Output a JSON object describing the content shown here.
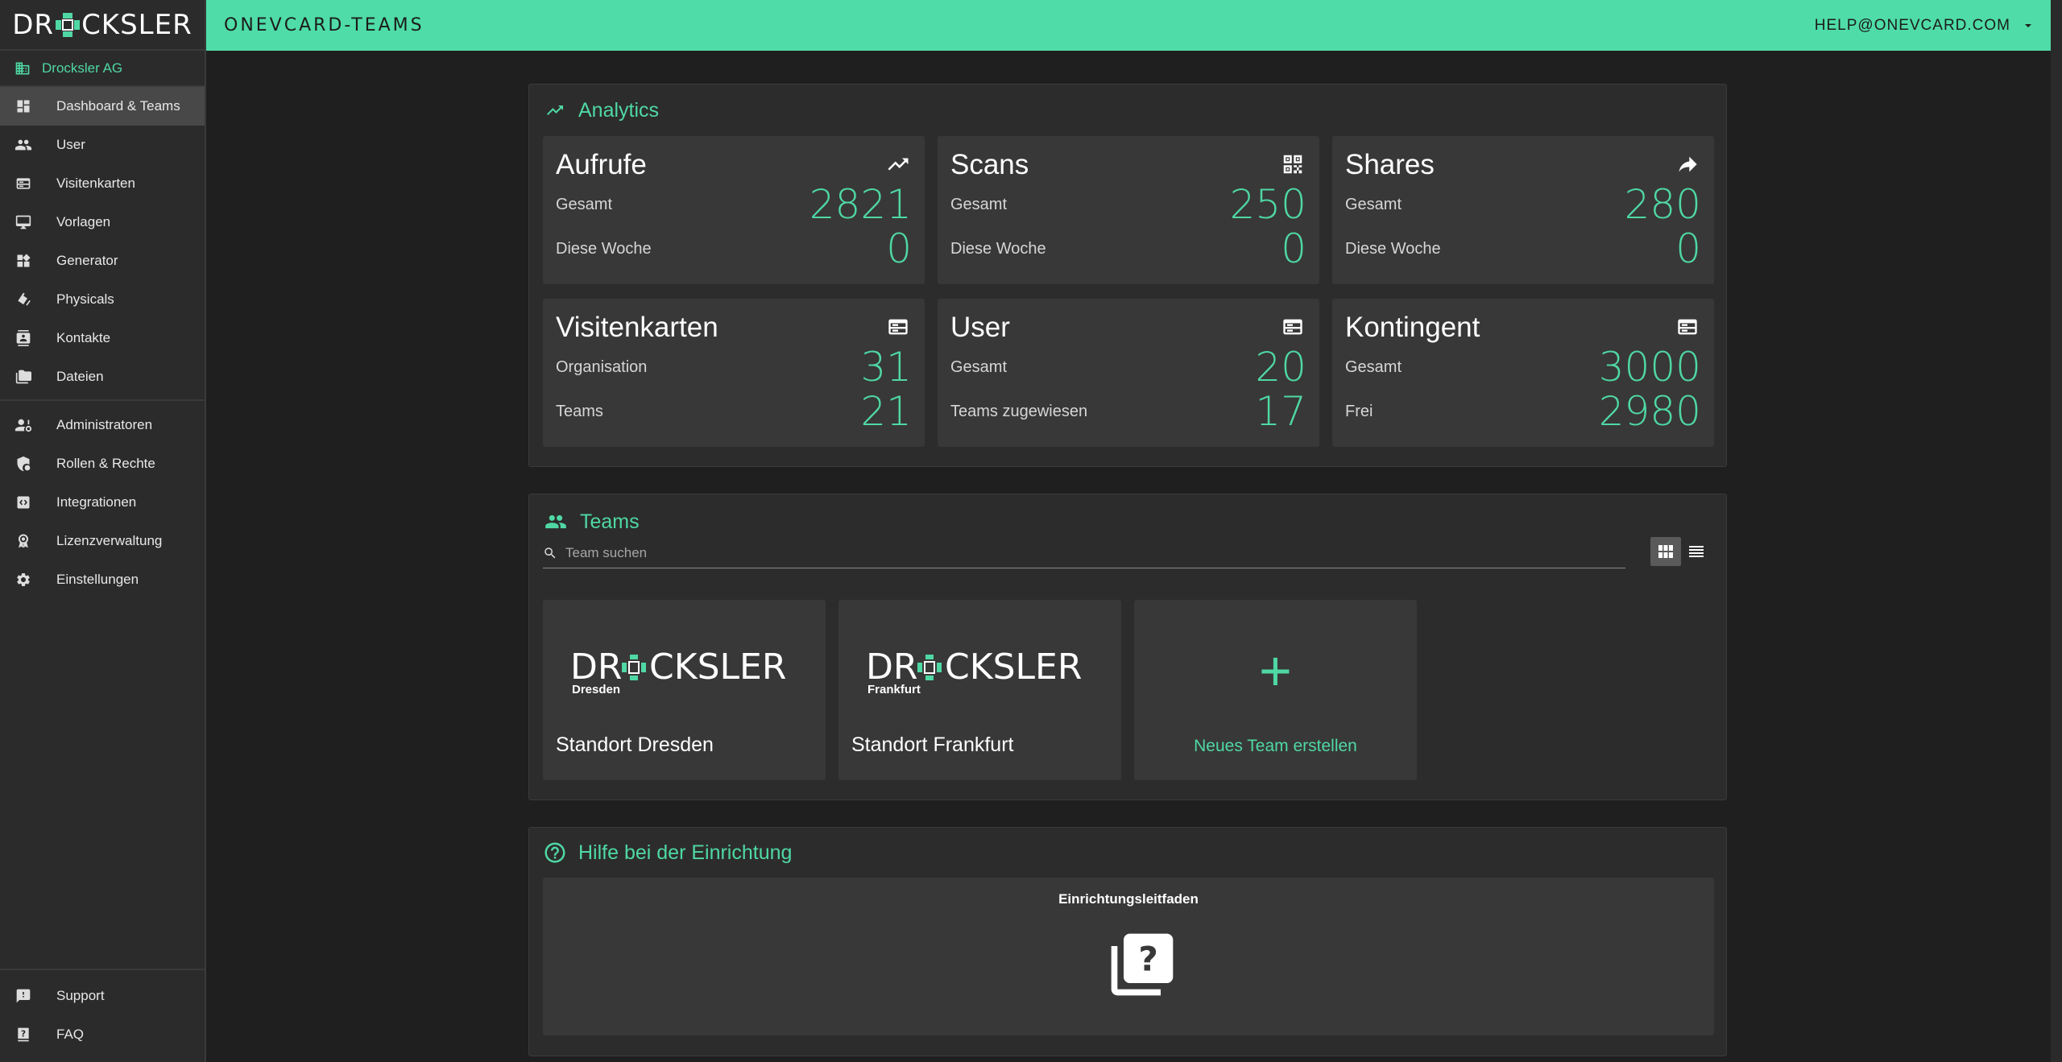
{
  "brand": {
    "logo_text_left": "DR",
    "logo_text_right": "CKSLER"
  },
  "app": {
    "title": "ONEVCARD-TEAMS",
    "account_email": "HELP@ONEVCARD.COM"
  },
  "sidebar": {
    "org": "Drocksler AG",
    "items": [
      {
        "label": "Dashboard & Teams",
        "icon": "dashboard-icon"
      },
      {
        "label": "User",
        "icon": "people-icon"
      },
      {
        "label": "Visitenkarten",
        "icon": "card-icon"
      },
      {
        "label": "Vorlagen",
        "icon": "monitor-icon"
      },
      {
        "label": "Generator",
        "icon": "widgets-icon"
      },
      {
        "label": "Physicals",
        "icon": "nfc-tag-icon"
      },
      {
        "label": "Kontakte",
        "icon": "contact-icon"
      },
      {
        "label": "Dateien",
        "icon": "folder-icon"
      },
      {
        "label": "Administratoren",
        "icon": "admin-icon"
      },
      {
        "label": "Rollen & Rechte",
        "icon": "shield-icon"
      },
      {
        "label": "Integrationen",
        "icon": "integration-icon"
      },
      {
        "label": "Lizenzverwaltung",
        "icon": "license-icon"
      },
      {
        "label": "Einstellungen",
        "icon": "gear-icon"
      }
    ],
    "bottom": [
      {
        "label": "Support",
        "icon": "support-icon"
      },
      {
        "label": "FAQ",
        "icon": "faq-icon"
      }
    ]
  },
  "analytics": {
    "title": "Analytics",
    "cards": [
      {
        "title": "Aufrufe",
        "icon": "trending-icon",
        "row1_label": "Gesamt",
        "row1_value": "2821",
        "row2_label": "Diese Woche",
        "row2_value": "0"
      },
      {
        "title": "Scans",
        "icon": "qr-code-icon",
        "row1_label": "Gesamt",
        "row1_value": "250",
        "row2_label": "Diese Woche",
        "row2_value": "0"
      },
      {
        "title": "Shares",
        "icon": "share-icon",
        "row1_label": "Gesamt",
        "row1_value": "280",
        "row2_label": "Diese Woche",
        "row2_value": "0"
      },
      {
        "title": "Visitenkarten",
        "icon": "card-icon",
        "row1_label": "Organisation",
        "row1_value": "31",
        "row2_label": "Teams",
        "row2_value": "21"
      },
      {
        "title": "User",
        "icon": "card-icon",
        "row1_label": "Gesamt",
        "row1_value": "20",
        "row2_label": "Teams zugewiesen",
        "row2_value": "17"
      },
      {
        "title": "Kontingent",
        "icon": "card-icon",
        "row1_label": "Gesamt",
        "row1_value": "3000",
        "row2_label": "Frei",
        "row2_value": "2980"
      }
    ]
  },
  "teams": {
    "title": "Teams",
    "search_placeholder": "Team suchen",
    "list": [
      {
        "name": "Standort Dresden",
        "logo_sub": "Dresden"
      },
      {
        "name": "Standort Frankfurt",
        "logo_sub": "Frankfurt"
      }
    ],
    "new_team_label": "Neues Team erstellen"
  },
  "help": {
    "title": "Hilfe bei der Einrichtung",
    "guide_title": "Einrichtungsleitfaden"
  },
  "colors": {
    "accent": "#4fd8a4",
    "topbar": "#4fdca9",
    "background": "#1f1f1f",
    "panel": "#2c2c2c",
    "card": "#383838"
  }
}
